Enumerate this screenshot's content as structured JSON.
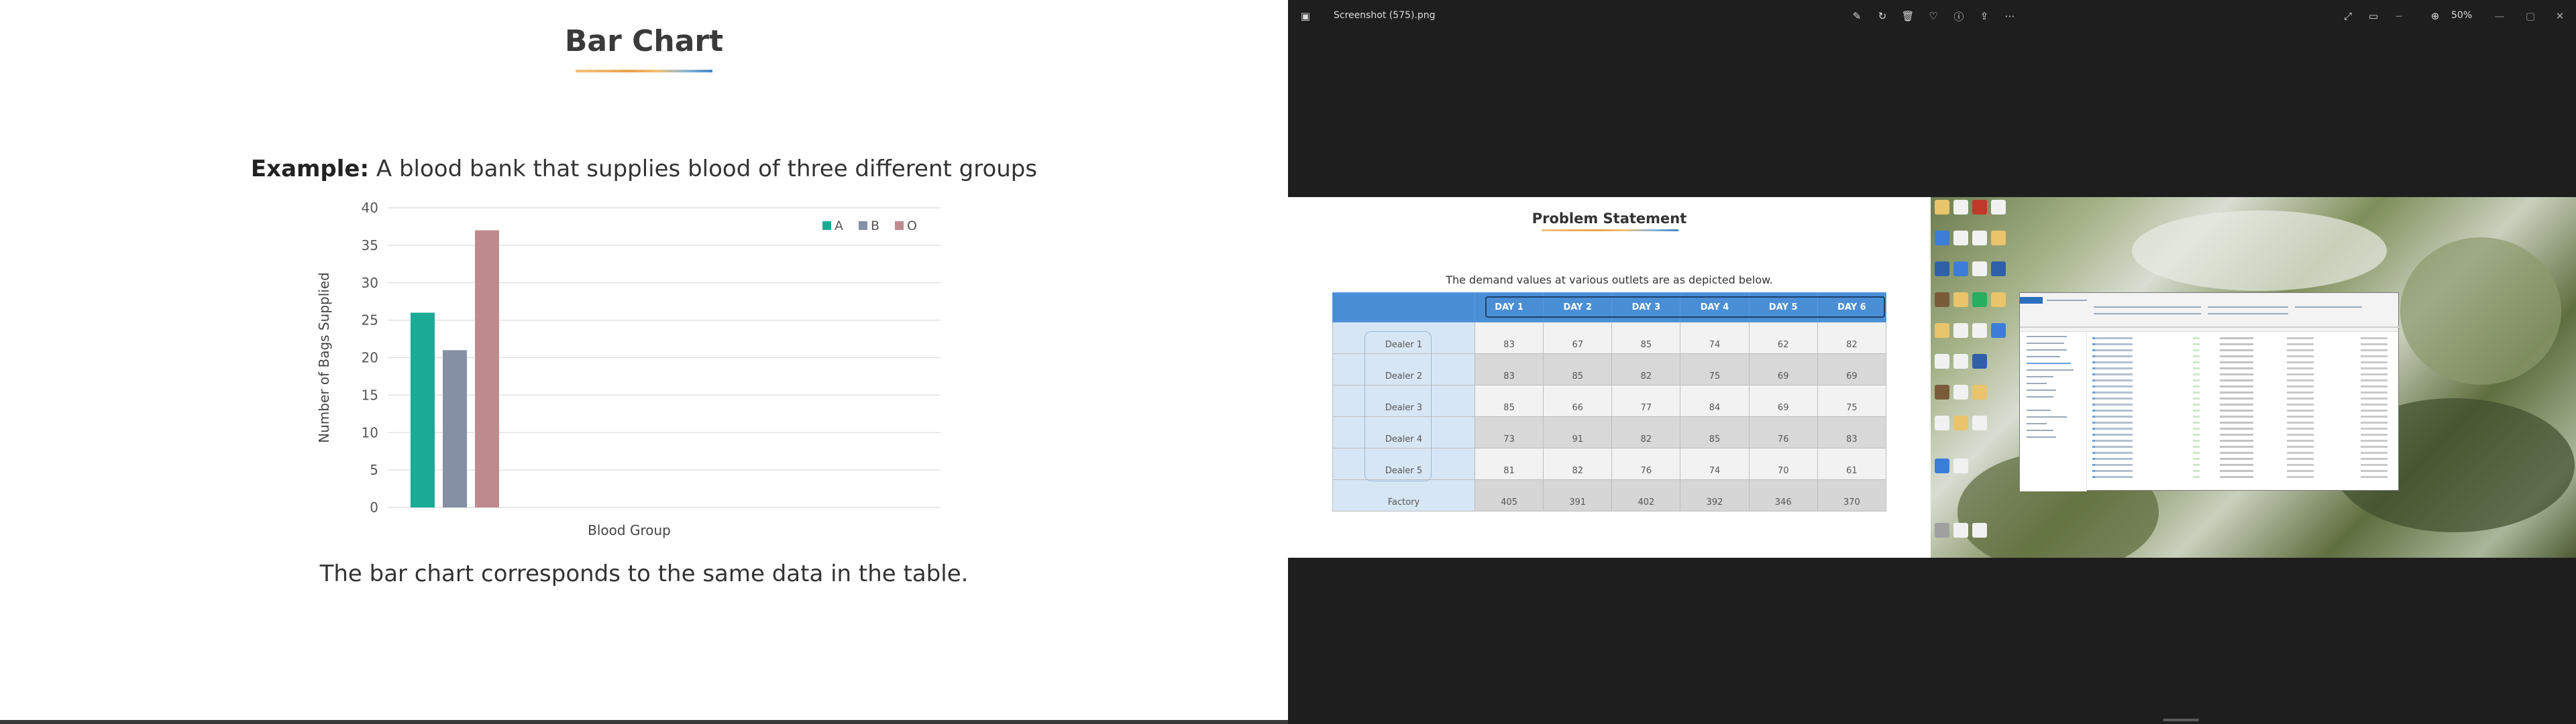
{
  "left_slide": {
    "title": "Bar Chart",
    "example_bold": "Example:",
    "example_text": " A blood bank that supplies blood of three different groups",
    "caption": "The bar chart corresponds to the same data in the table."
  },
  "chart_data": {
    "type": "bar",
    "categories": [
      "Blood Group"
    ],
    "series": [
      {
        "name": "A",
        "values": [
          26
        ],
        "color": "#1aab95"
      },
      {
        "name": "B",
        "values": [
          21
        ],
        "color": "#8490a4"
      },
      {
        "name": "O",
        "values": [
          37
        ],
        "color": "#bf8a8e"
      }
    ],
    "title": "",
    "xlabel": "Blood Group",
    "ylabel": "Number of Bags Supplied",
    "ylim": [
      0,
      40
    ],
    "yticks": [
      "0",
      "5",
      "10",
      "15",
      "20",
      "25",
      "30",
      "35",
      "40"
    ],
    "grid": true,
    "legend_position": "top-right"
  },
  "viewer": {
    "file_title": "Screenshot (575).png",
    "zoom": "50%",
    "icons": [
      "photos-app-icon",
      "edit-icon",
      "rotate-icon",
      "delete-icon",
      "favorite-icon",
      "info-icon",
      "share-icon",
      "more-icon",
      "fullscreen-icon",
      "filmstrip-icon",
      "zoom-out-icon",
      "zoom-in-icon",
      "minimize-icon",
      "maximize-icon",
      "close-icon"
    ]
  },
  "embedded": {
    "title": "Problem Statement",
    "description": "The demand values at various outlets are as depicted below.",
    "columns": [
      "",
      "DAY 1",
      "DAY 2",
      "DAY 3",
      "DAY 4",
      "DAY 5",
      "DAY 6"
    ],
    "rows": [
      {
        "label": "Dealer 1",
        "values": [
          "83",
          "67",
          "85",
          "74",
          "62",
          "82"
        ]
      },
      {
        "label": "Dealer 2",
        "values": [
          "83",
          "85",
          "82",
          "75",
          "69",
          "69"
        ]
      },
      {
        "label": "Dealer 3",
        "values": [
          "85",
          "66",
          "77",
          "84",
          "69",
          "75"
        ]
      },
      {
        "label": "Dealer 4",
        "values": [
          "73",
          "91",
          "82",
          "85",
          "76",
          "83"
        ]
      },
      {
        "label": "Dealer 5",
        "values": [
          "81",
          "82",
          "76",
          "74",
          "70",
          "61"
        ]
      },
      {
        "label": "Factory",
        "values": [
          "405",
          "391",
          "402",
          "392",
          "346",
          "370"
        ]
      }
    ]
  }
}
